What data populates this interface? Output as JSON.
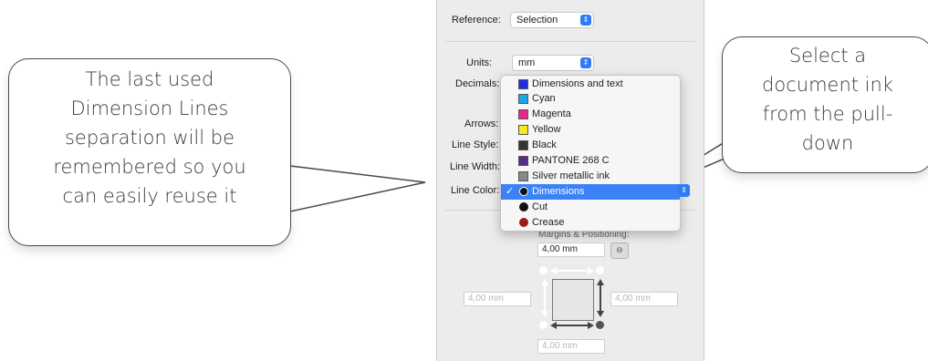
{
  "callouts": {
    "left": {
      "lines": [
        "The last used",
        "Dimension Lines",
        "separation will be",
        "remembered so you",
        "can easily reuse it"
      ]
    },
    "right": {
      "lines": [
        "Select a",
        "document ink",
        "from the pull-",
        "down"
      ]
    }
  },
  "panel": {
    "reference_label": "Reference:",
    "reference_value": "Selection",
    "units_label": "Units:",
    "units_value": "mm",
    "decimals_label": "Decimals:",
    "arrows_label": "Arrows:",
    "line_style_label": "Line Style:",
    "line_width_label": "Line Width:",
    "line_color_label": "Line Color:",
    "margins_title": "Margins & Positioning:",
    "margin_top": "4,00 mm",
    "margin_left": "4,00 mm",
    "margin_right": "4,00 mm",
    "margin_bottom": "4,00 mm"
  },
  "ink_menu": {
    "items": [
      {
        "label": "Dimensions and text",
        "swatch": "#1f2fe0",
        "shape": "square"
      },
      {
        "label": "Cyan",
        "swatch": "#1ea7e6",
        "shape": "square"
      },
      {
        "label": "Magenta",
        "swatch": "#e6298a",
        "shape": "square"
      },
      {
        "label": "Yellow",
        "swatch": "#f4ea21",
        "shape": "square"
      },
      {
        "label": "Black",
        "swatch": "#333333",
        "shape": "square"
      },
      {
        "label": "PANTONE 268 C",
        "swatch": "#5a2b86",
        "shape": "square"
      },
      {
        "label": "Silver metallic ink",
        "swatch": "#888888",
        "shape": "square"
      },
      {
        "label": "Dimensions",
        "swatch": "#111111",
        "shape": "dot",
        "selected": true
      },
      {
        "label": "Cut",
        "swatch": "#111111",
        "shape": "dot"
      },
      {
        "label": "Crease",
        "swatch": "#9b1c1c",
        "shape": "dot"
      }
    ],
    "check_glyph": "✓"
  },
  "icons": {
    "stepper": "updown-stepper-icon",
    "link": "chain-link-icon"
  }
}
